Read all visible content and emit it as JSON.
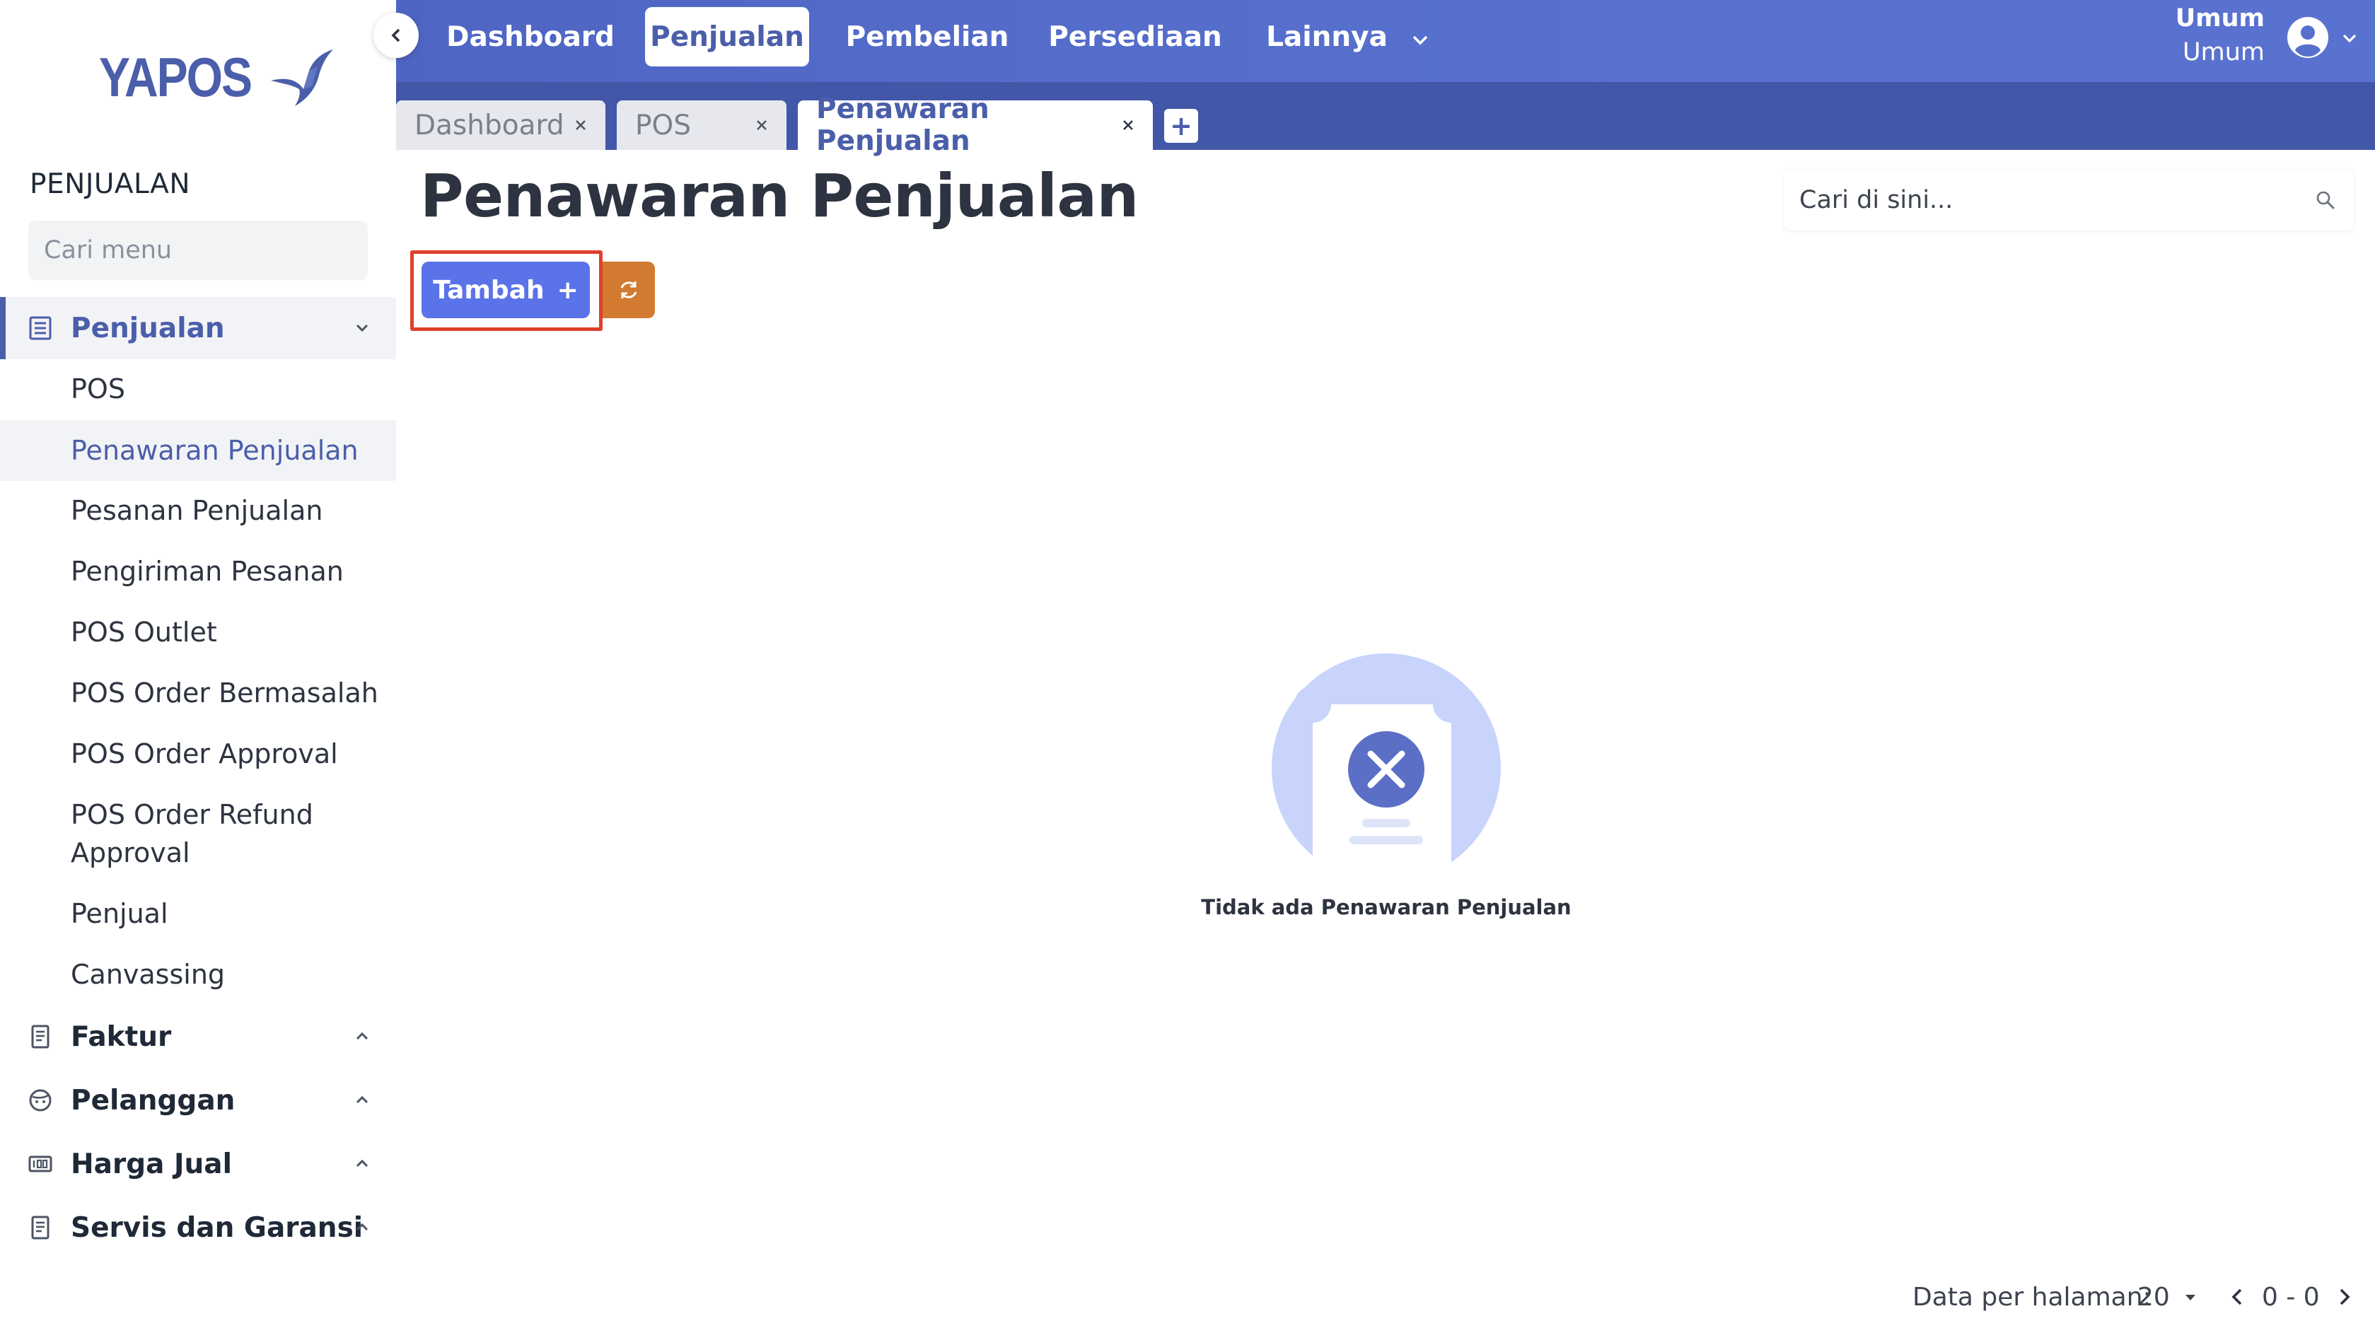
{
  "app": {
    "logo_text": "YAPOS"
  },
  "sidebar": {
    "section_title": "PENJUALAN",
    "search_placeholder": "Cari menu",
    "groups": [
      {
        "label": "Penjualan",
        "icon": "list-icon",
        "expanded": true
      },
      {
        "label": "Faktur",
        "icon": "receipt-icon",
        "expanded": false
      },
      {
        "label": "Pelanggan",
        "icon": "face-icon",
        "expanded": false
      },
      {
        "label": "Harga Jual",
        "icon": "price-tag-icon",
        "expanded": false
      },
      {
        "label": "Servis dan Garansi",
        "icon": "receipt-icon",
        "expanded": false
      }
    ],
    "sub_items": [
      "POS",
      "Penawaran Penjualan",
      "Pesanan Penjualan",
      "Pengiriman Pesanan",
      "POS Outlet",
      "POS Order Bermasalah",
      "POS Order Approval",
      "POS Order Refund Approval",
      "Penjual",
      "Canvassing"
    ],
    "selected_sub_item": "Penawaran Penjualan"
  },
  "topbar": {
    "nav": [
      "Dashboard",
      "Penjualan",
      "Pembelian",
      "Persediaan",
      "Lainnya"
    ],
    "active_nav": "Penjualan",
    "user_line1": "Umum",
    "user_line2": "Umum"
  },
  "tabs": {
    "items": [
      "Dashboard",
      "POS",
      "Penawaran Penjualan"
    ],
    "active": "Penawaran Penjualan",
    "add_label": "+"
  },
  "main": {
    "title": "Penawaran Penjualan",
    "search_placeholder": "Cari di sini...",
    "add_button_label": "Tambah",
    "add_button_symbol": "+",
    "empty_message": "Tidak ada Penawaran Penjualan"
  },
  "pagination": {
    "per_page_label": "Data per halaman:",
    "per_page_value": "20",
    "range": "0 - 0"
  },
  "colors": {
    "brand": "#4b5eaa",
    "topbar": "#5770ce",
    "tabbar": "#4357a8",
    "add_button": "#5b73e8",
    "refresh_button": "#d27b30",
    "highlight": "#e0402b"
  }
}
